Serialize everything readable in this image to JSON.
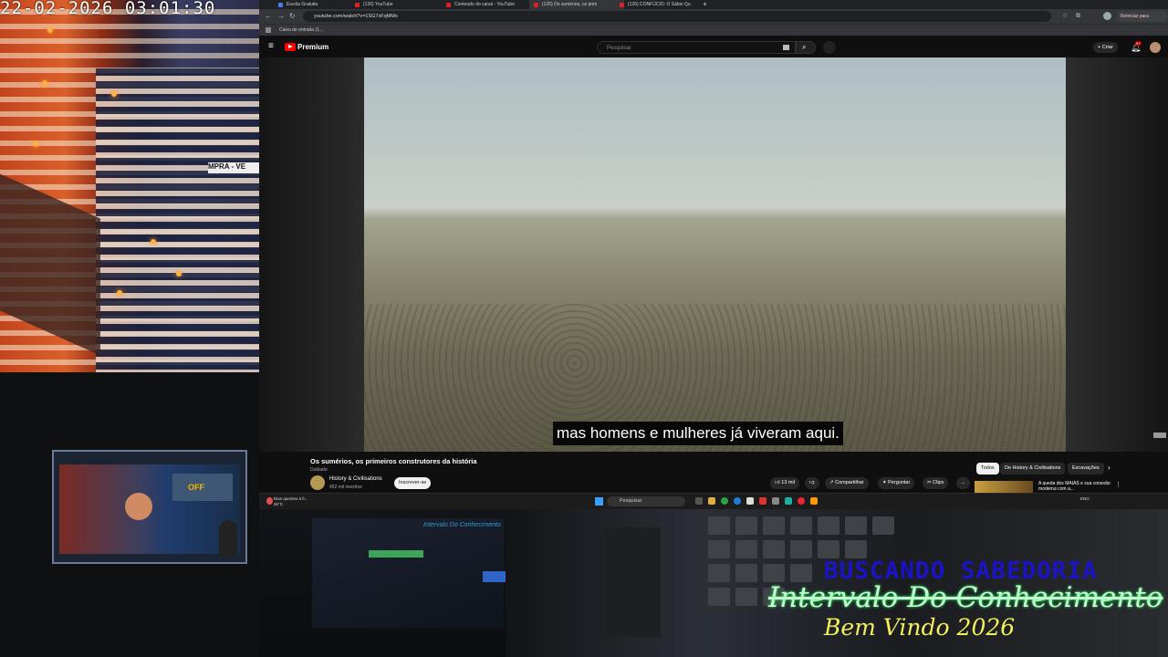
{
  "webcam": {
    "timestamp": "22-02-2026  03:01:30",
    "sign_text": "MPRA - VE"
  },
  "browser": {
    "tabs": [
      {
        "label": "Escola Gratuita"
      },
      {
        "label": "(126) YouTube"
      },
      {
        "label": "Conteúdo do canal - YouTube"
      },
      {
        "label": "(126) Os sumérios, os prim"
      },
      {
        "label": "(126) CONFÚCIO: O Sábio Qu"
      }
    ],
    "new_tab": "+",
    "url": "youtube.com/watch?v=1SG7xFqMMo",
    "reiniciar": "Reiniciar para atualizar",
    "bookmark": "Caixa de entrada (1..."
  },
  "youtube": {
    "brand": "Premium",
    "search_placeholder": "Pesquisar",
    "criar": "+ Criar",
    "notification_count": "9+",
    "subtitle": "mas homens e mulheres já viveram aqui.",
    "video_title": "Os sumérios, os primeiros construtores da história",
    "dubbed": "Dublado",
    "channel_name": "History & Civilisations",
    "channel_subs": "452 mil inscritos",
    "subscribe": "Inscrever-se",
    "actions": {
      "likes": "13 mil",
      "share": "Compartilhar",
      "download": "Perguntar",
      "clip": "Clips",
      "more": "..."
    },
    "chips": [
      "Todos",
      "De History & Civilisations",
      "Escavações"
    ],
    "rec_title": "A queda dos MAIAS e sua conexão moderna com a..."
  },
  "taskbar": {
    "weather": "Dias quentes à fr...",
    "weather_temp": "26°C",
    "search": "Pesquisar",
    "tray": "ENG"
  },
  "studio": {
    "monitor_off": "OFF",
    "screen_title": "Intervalo Do Conhecimento"
  },
  "overlay": {
    "line1": "BUSCANDO SABEDORIA",
    "line2": "Intervalo Do Conhecimento",
    "line3": "Bem Vindo 2026"
  }
}
